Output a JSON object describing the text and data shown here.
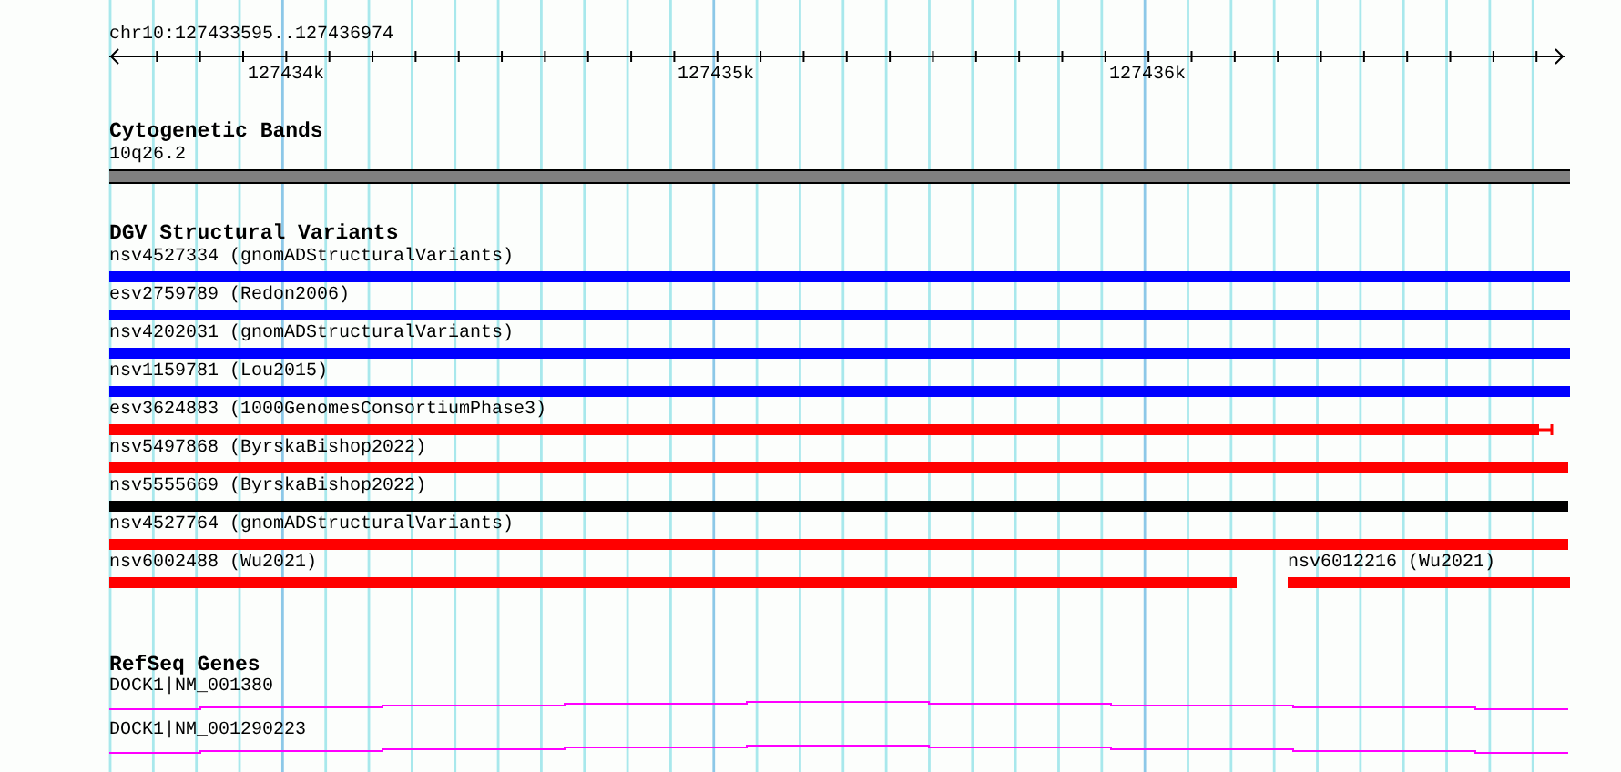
{
  "ruler": {
    "region": "chr10:127433595..127436974",
    "ticks": [
      "127434k",
      "127435k",
      "127436k"
    ]
  },
  "tracks": [
    {
      "kind": "bands",
      "title": "Cytogenetic Bands",
      "rows": [
        [
          {
            "label": "10q26.2",
            "color": "#808080"
          }
        ]
      ]
    },
    {
      "kind": "variants",
      "title": "DGV Structural Variants",
      "rows": [
        [
          {
            "label": "nsv4527334 (gnomADStructuralVariants)",
            "color": "#0000ff"
          }
        ],
        [
          {
            "label": "esv2759789 (Redon2006)",
            "color": "#0000ff"
          }
        ],
        [
          {
            "label": "nsv4202031 (gnomADStructuralVariants)",
            "color": "#0000ff"
          }
        ],
        [
          {
            "label": "nsv1159781 (Lou2015)",
            "color": "#0000ff"
          }
        ],
        [
          {
            "label": "esv3624883 (1000GenomesConsortiumPhase3)",
            "color": "#ff0000"
          }
        ],
        [
          {
            "label": "nsv5497868 (ByrskaBishop2022)",
            "color": "#ff0000"
          }
        ],
        [
          {
            "label": "nsv5555669 (ByrskaBishop2022)",
            "color": "#000000"
          }
        ],
        [
          {
            "label": "nsv4527764 (gnomADStructuralVariants)",
            "color": "#ff0000"
          }
        ],
        [
          {
            "label": "nsv6002488 (Wu2021)",
            "color": "#ff0000"
          },
          {
            "label": "nsv6012216 (Wu2021)",
            "color": "#ff0000"
          }
        ]
      ]
    },
    {
      "kind": "genes",
      "title": "RefSeq Genes",
      "rows": [
        [
          {
            "label": "DOCK1|NM_001380",
            "color": "#ff00ff"
          }
        ],
        [
          {
            "label": "DOCK1|NM_001290223",
            "color": "#ff00ff"
          }
        ]
      ]
    }
  ]
}
